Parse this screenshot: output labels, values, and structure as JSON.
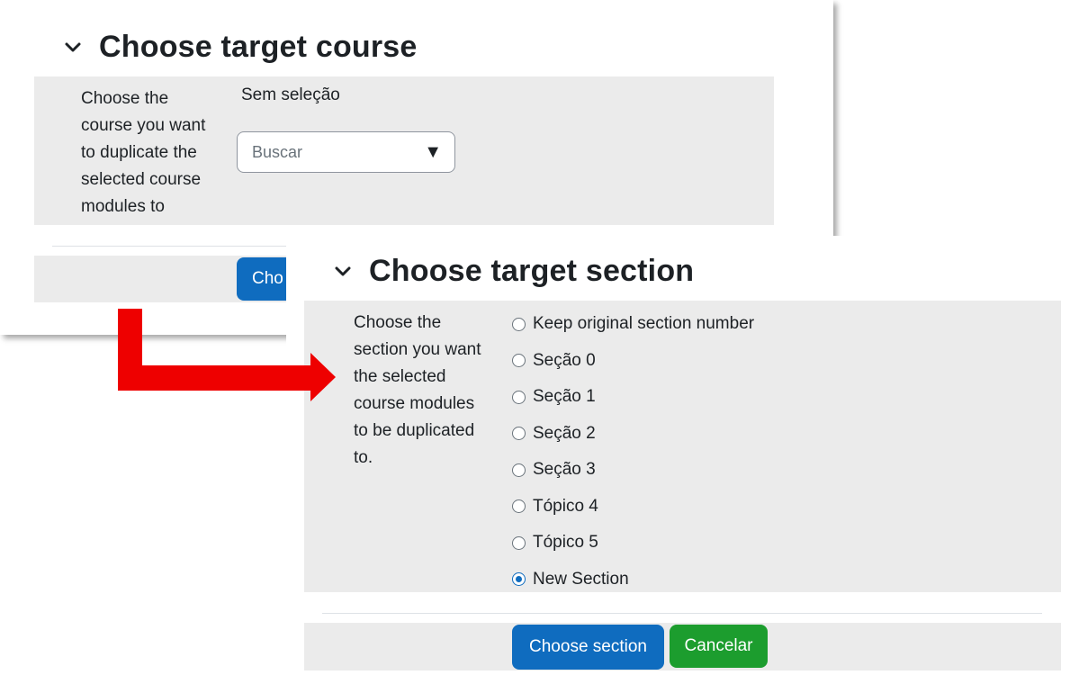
{
  "target_course": {
    "heading": "Choose target course",
    "description": "Choose the course you want to duplicate the selected course modules to",
    "selection_label": "Sem seleção",
    "search_placeholder": "Buscar",
    "button_label": "Cho"
  },
  "target_section": {
    "heading": "Choose target section",
    "description": "Choose the section you want the selected course modules to be duplicated to.",
    "options": [
      {
        "label": "Keep original section number",
        "checked": false
      },
      {
        "label": "Seção 0",
        "checked": false
      },
      {
        "label": "Seção 1",
        "checked": false
      },
      {
        "label": "Seção 2",
        "checked": false
      },
      {
        "label": "Seção 3",
        "checked": false
      },
      {
        "label": "Tópico 4",
        "checked": false
      },
      {
        "label": "Tópico 5",
        "checked": false
      },
      {
        "label": "New Section",
        "checked": true
      }
    ],
    "submit_label": "Choose section",
    "cancel_label": "Cancelar"
  },
  "colors": {
    "primary": "#0f6cbf",
    "success": "#1c9d2e",
    "arrow": "#ee0000",
    "panel_bg": "#ebebeb"
  }
}
